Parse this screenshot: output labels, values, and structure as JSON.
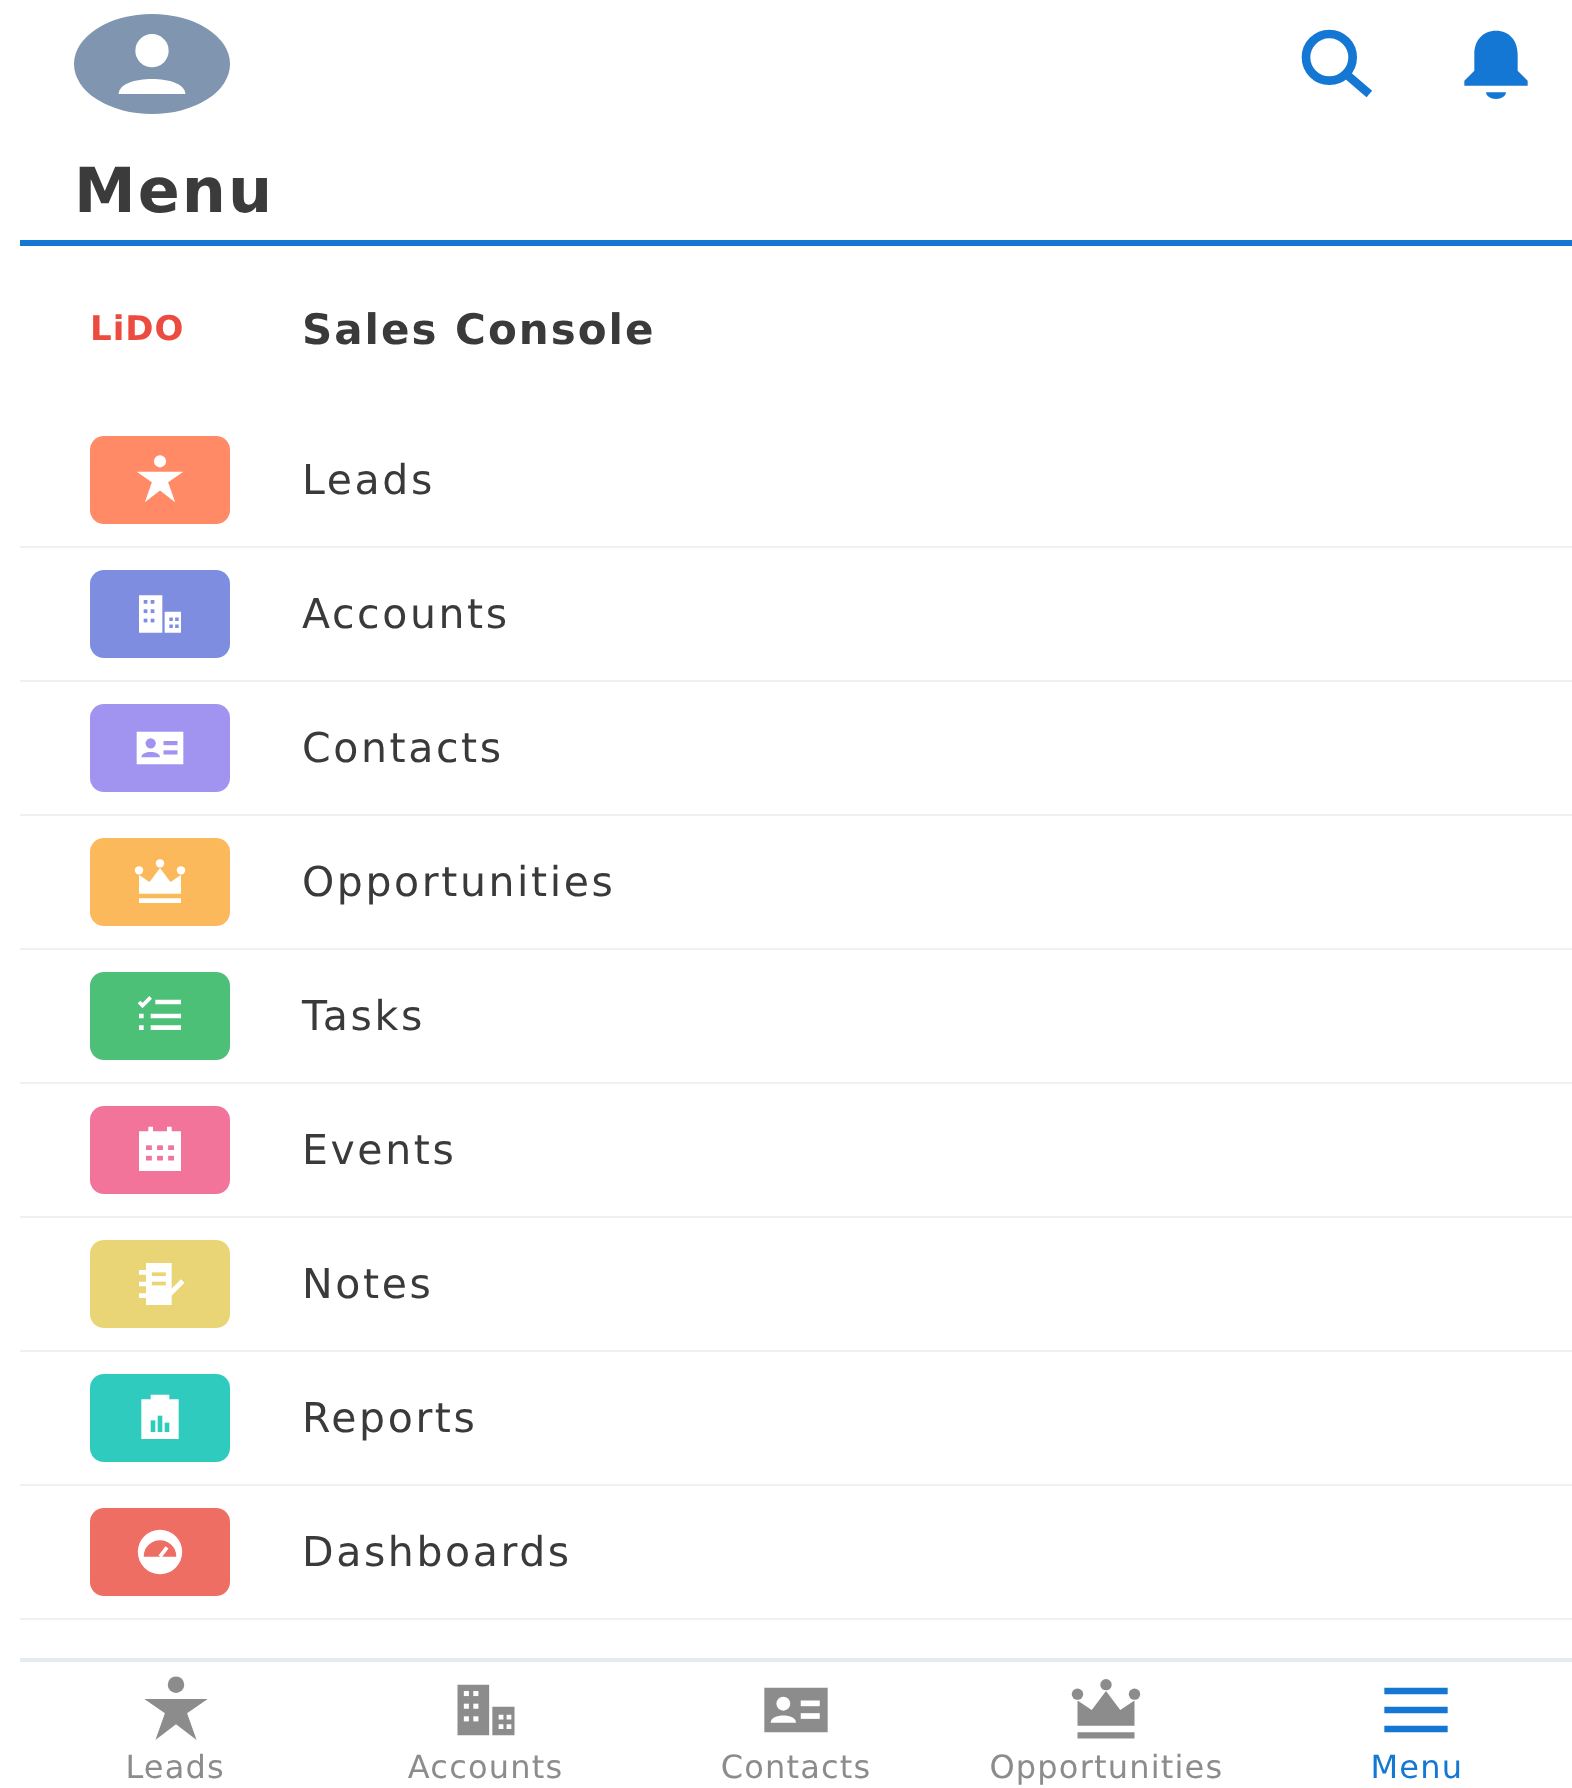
{
  "header": {
    "title": "Menu"
  },
  "app": {
    "logo": "LiDO",
    "name": "Sales Console"
  },
  "menu_items": [
    {
      "label": "Leads",
      "kind": "lead",
      "color": "#ff8a65"
    },
    {
      "label": "Accounts",
      "kind": "account",
      "color": "#7f8de1"
    },
    {
      "label": "Contacts",
      "kind": "contact",
      "color": "#a094f0"
    },
    {
      "label": "Opportunities",
      "kind": "opportunity",
      "color": "#fcb95b"
    },
    {
      "label": "Tasks",
      "kind": "task",
      "color": "#4bc076"
    },
    {
      "label": "Events",
      "kind": "event",
      "color": "#f2749a"
    },
    {
      "label": "Notes",
      "kind": "note",
      "color": "#e9d576"
    },
    {
      "label": "Reports",
      "kind": "report",
      "color": "#2ecbbe"
    },
    {
      "label": "Dashboards",
      "kind": "dashboard",
      "color": "#ef6e64"
    }
  ],
  "tab_bar": [
    {
      "label": "Leads",
      "kind": "lead",
      "selected": false
    },
    {
      "label": "Accounts",
      "kind": "account",
      "selected": false
    },
    {
      "label": "Contacts",
      "kind": "contact",
      "selected": false
    },
    {
      "label": "Opportunities",
      "kind": "opportunity",
      "selected": false
    },
    {
      "label": "Menu",
      "kind": "menu",
      "selected": true
    }
  ]
}
